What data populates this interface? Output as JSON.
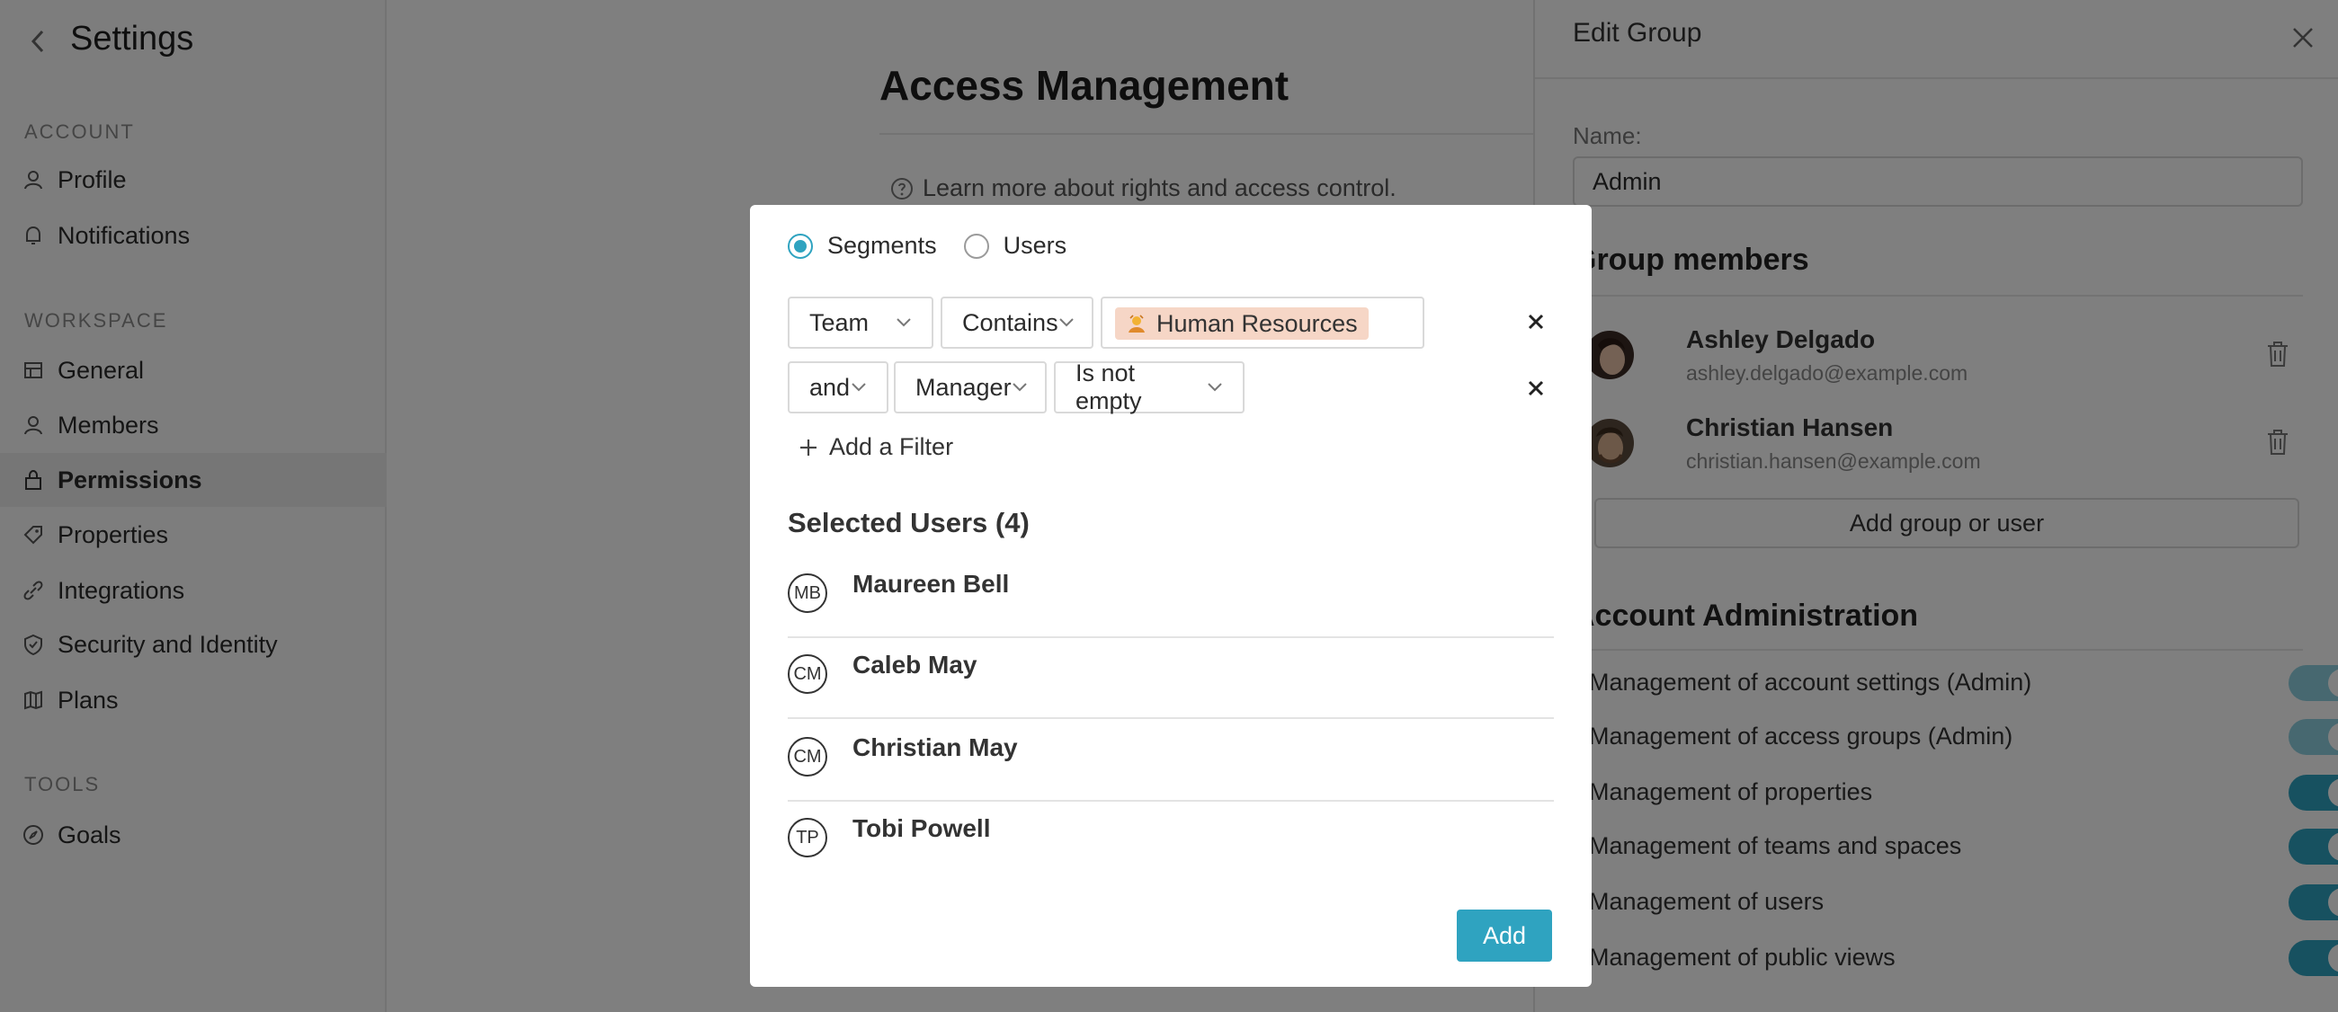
{
  "sidebar": {
    "title": "Settings",
    "sections": [
      {
        "label": "ACCOUNT",
        "items": [
          {
            "label": "Profile",
            "icon": "person-icon"
          },
          {
            "label": "Notifications",
            "icon": "bell-icon"
          }
        ]
      },
      {
        "label": "WORKSPACE",
        "items": [
          {
            "label": "General",
            "icon": "panel-icon"
          },
          {
            "label": "Members",
            "icon": "person-icon"
          },
          {
            "label": "Permissions",
            "icon": "lock-icon",
            "active": true
          },
          {
            "label": "Properties",
            "icon": "tag-icon"
          },
          {
            "label": "Integrations",
            "icon": "link-icon"
          },
          {
            "label": "Security and Identity",
            "icon": "shield-icon"
          },
          {
            "label": "Plans",
            "icon": "map-icon"
          }
        ]
      },
      {
        "label": "TOOLS",
        "items": [
          {
            "label": "Goals",
            "icon": "compass-icon"
          }
        ]
      }
    ]
  },
  "main": {
    "title": "Access Management",
    "learn_more": "Learn more about rights and access control."
  },
  "panel": {
    "title": "Edit Group",
    "name_label": "Name:",
    "name_value": "Admin",
    "members_title": "Group members",
    "members": [
      {
        "name": "Ashley Delgado",
        "email": "ashley.delgado@example.com"
      },
      {
        "name": "Christian Hansen",
        "email": "christian.hansen@example.com"
      }
    ],
    "add_member_label": "Add group or user",
    "admin_title": "Account Administration",
    "permissions": [
      {
        "label": "Management of account settings (Admin)",
        "on": true,
        "locked": true
      },
      {
        "label": "Management of access groups (Admin)",
        "on": true,
        "locked": true
      },
      {
        "label": "Management of properties",
        "on": true,
        "locked": false
      },
      {
        "label": "Management of teams and spaces",
        "on": true,
        "locked": false
      },
      {
        "label": "Management of users",
        "on": true,
        "locked": false
      },
      {
        "label": "Management of public views",
        "on": true,
        "locked": false
      }
    ]
  },
  "modal": {
    "radio": {
      "segments": "Segments",
      "users": "Users",
      "selected": "segments"
    },
    "filters": {
      "row1": {
        "field": "Team",
        "operator": "Contains",
        "value": "Human Resources"
      },
      "row2": {
        "conjunction": "and",
        "field": "Manager",
        "operator": "Is not empty"
      }
    },
    "add_filter": "Add a Filter",
    "selected_title": "Selected Users (4)",
    "users": [
      {
        "initials": "MB",
        "name": "Maureen Bell"
      },
      {
        "initials": "CM",
        "name": "Caleb May"
      },
      {
        "initials": "CM",
        "name": "Christian May"
      },
      {
        "initials": "TP",
        "name": "Tobi Powell"
      }
    ],
    "add_button": "Add"
  },
  "colors": {
    "accent": "#2fa3c0",
    "chip": "#f6d6c6",
    "overlay": "rgba(0,0,0,0.5)"
  }
}
